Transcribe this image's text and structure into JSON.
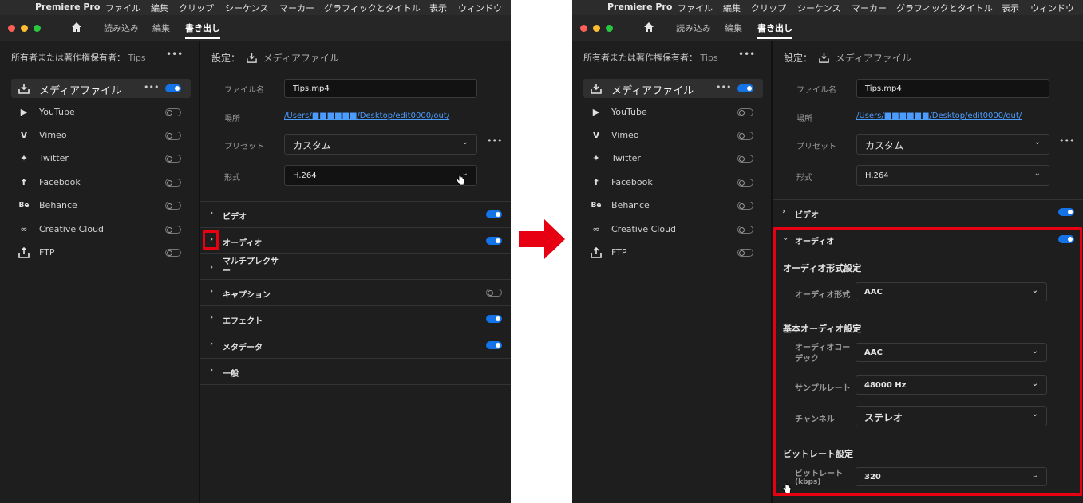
{
  "menubar": {
    "apple": "",
    "app": "Premiere Pro",
    "items": [
      "ファイル",
      "編集",
      "クリップ",
      "シーケンス",
      "マーカー",
      "グラフィックとタイトル",
      "表示",
      "ウィンドウ"
    ]
  },
  "tabs": [
    "読み込み",
    "編集",
    "書き出し"
  ],
  "sidebar": {
    "owner_label": "所有者または著作権保有者：",
    "owner_value": "Tips",
    "items": [
      {
        "label": "メディアファイル",
        "icon": "download-icon",
        "on": true
      },
      {
        "label": "YouTube",
        "icon": "youtube-icon",
        "on": false
      },
      {
        "label": "Vimeo",
        "icon": "vimeo-icon",
        "on": false
      },
      {
        "label": "Twitter",
        "icon": "twitter-icon",
        "on": false
      },
      {
        "label": "Facebook",
        "icon": "facebook-icon",
        "on": false
      },
      {
        "label": "Behance",
        "icon": "behance-icon",
        "on": false
      },
      {
        "label": "Creative Cloud",
        "icon": "creative-cloud-icon",
        "on": false
      },
      {
        "label": "FTP",
        "icon": "upload-icon",
        "on": false
      }
    ]
  },
  "settings": {
    "header_label": "設定：",
    "header_value": "メディアファイル",
    "filename_label": "ファイル名",
    "filename_value": "Tips.mp4",
    "location_label": "場所",
    "location_value": "/Users/■■■■■■/Desktop/edit0000/out/",
    "preset_label": "プリセット",
    "preset_value": "カスタム",
    "format_label": "形式",
    "format_value": "H.264"
  },
  "sections_left": [
    "ビデオ",
    "オーディオ",
    "マルチプレクサー",
    "キャプション",
    "エフェクト",
    "メタデータ",
    "一般"
  ],
  "audio": {
    "video_label": "ビデオ",
    "audio_label": "オーディオ",
    "format_heading": "オーディオ形式設定",
    "format_label": "オーディオ形式",
    "format_value": "AAC",
    "basic_heading": "基本オーディオ設定",
    "codec_label": "オーディオコーデック",
    "codec_value": "AAC",
    "rate_label": "サンプルレート",
    "rate_value": "48000 Hz",
    "channel_label": "チャンネル",
    "channel_value": "ステレオ",
    "bitrate_heading": "ビットレート設定",
    "bitrate_label": "ビットレート",
    "bitrate_unit": "(kbps)",
    "bitrate_value": "320"
  },
  "colors": {
    "accent": "#1473e6",
    "highlight": "#e60012",
    "bg": "#1e1e1e"
  }
}
